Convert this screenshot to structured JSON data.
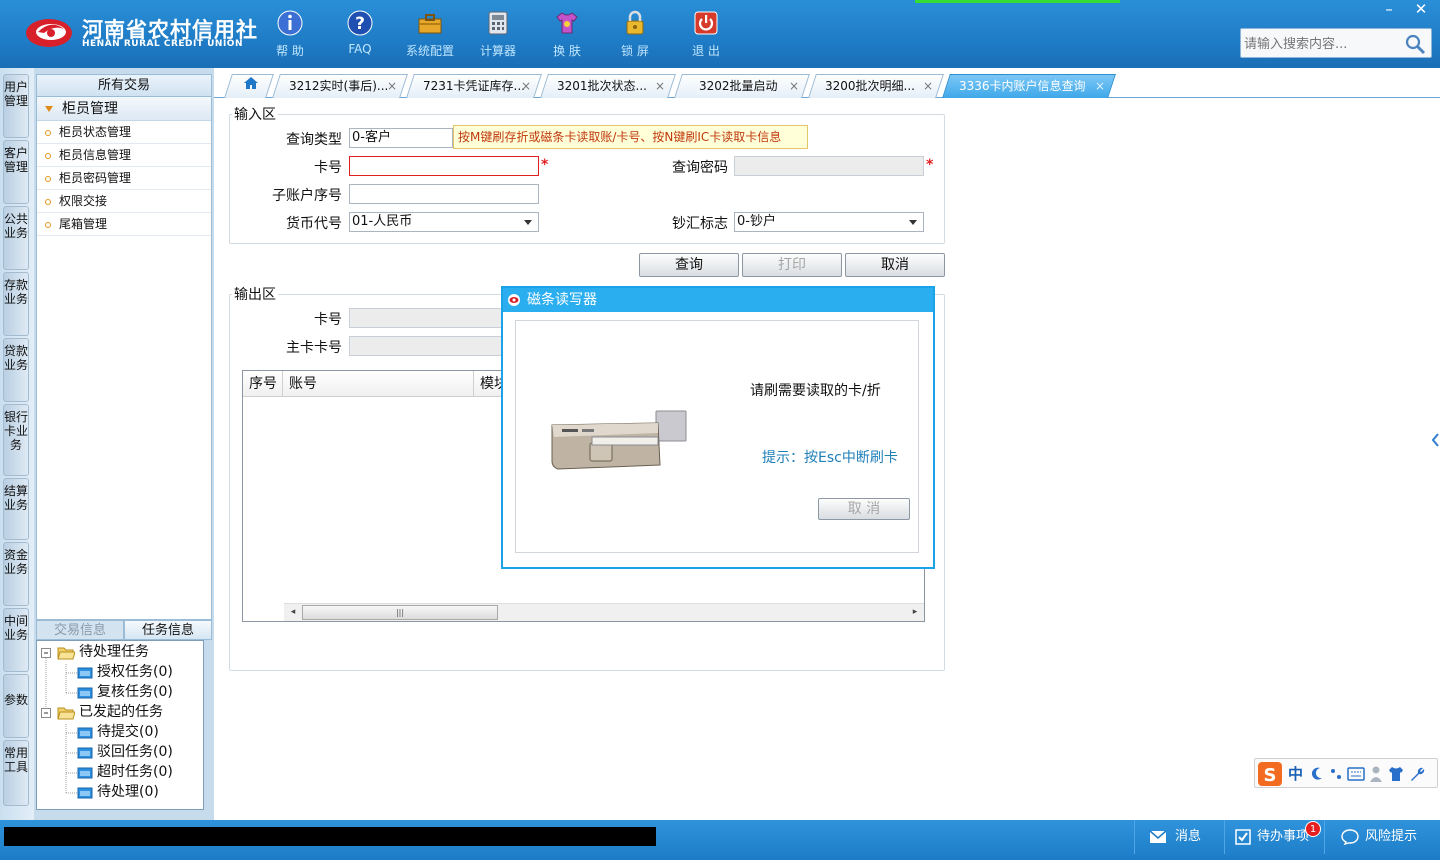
{
  "brand": {
    "name_cn": "河南省农村信用社",
    "name_en": "HENAN RURAL CREDIT UNION"
  },
  "toolbar": [
    {
      "label": "帮 助",
      "icon": "info-icon"
    },
    {
      "label": "FAQ",
      "icon": "question-icon"
    },
    {
      "label": "系统配置",
      "icon": "toolbox-icon"
    },
    {
      "label": "计算器",
      "icon": "calculator-icon"
    },
    {
      "label": "换 肤",
      "icon": "tshirt-icon"
    },
    {
      "label": "锁 屏",
      "icon": "lock-icon"
    },
    {
      "label": "退 出",
      "icon": "power-icon"
    }
  ],
  "window": {
    "minimize": "–",
    "close": "✕"
  },
  "search": {
    "placeholder": "请输入搜索内容..."
  },
  "vertical_tabs": [
    "用户管理",
    "客户管理",
    "公共业务",
    "存款业务",
    "贷款业务",
    "银行卡业务",
    "结算业务",
    "资金业务",
    "中间业务",
    "参数",
    "常用工具"
  ],
  "nav": {
    "header": "所有交易",
    "group": "柜员管理",
    "items": [
      "柜员状态管理",
      "柜员信息管理",
      "柜员密码管理",
      "权限交接",
      "尾箱管理"
    ]
  },
  "info_tabs": [
    "交易信息",
    "任务信息"
  ],
  "tree": {
    "pending": "待处理任务",
    "pending_children": [
      "授权任务(0)",
      "复核任务(0)"
    ],
    "initiated": "已发起的任务",
    "initiated_children": [
      "待提交(0)",
      "驳回任务(0)",
      "超时任务(0)",
      "待处理(0)"
    ]
  },
  "tabs": [
    {
      "label": "3212实时(事后)..."
    },
    {
      "label": "7231卡凭证库存..."
    },
    {
      "label": "3201批次状态..."
    },
    {
      "label": "3202批量启动"
    },
    {
      "label": "3200批次明细..."
    },
    {
      "label": "3336卡内账户信息查询"
    }
  ],
  "form": {
    "input_legend": "输入区",
    "query_type_label": "查询类型",
    "query_type_value": "0-客户",
    "card_no_label": "卡号",
    "card_no_value": "",
    "password_label": "查询密码",
    "sub_account_label": "子账户序号",
    "currency_label": "货币代号",
    "currency_value": "01-人民币",
    "cash_flag_label": "钞汇标志",
    "cash_flag_value": "0-钞户",
    "required_mark": "*",
    "tooltip": "按M键刷存折或磁条卡读取账/卡号、按N键刷IC卡读取卡信息"
  },
  "buttons": {
    "query": "查询",
    "print": "打印",
    "cancel": "取消"
  },
  "output": {
    "legend": "输出区",
    "card_no_label": "卡号",
    "main_card_label": "主卡卡号",
    "grid_columns": [
      "序号",
      "账号",
      "模块"
    ]
  },
  "dialog": {
    "title": "磁条读写器",
    "message": "请刷需要读取的卡/折",
    "hint": "提示：按Esc中断刷卡",
    "cancel": "取 消"
  },
  "ime": {
    "label": "中"
  },
  "statusbar": {
    "messages": "消息",
    "todo": "待办事项",
    "todo_count": "1",
    "risk": "风险提示"
  },
  "colors": {
    "header_blue": "#1f7cc6",
    "accent_active_tab": "#3ea8ea",
    "dialog_border": "#1aa3e8",
    "error_red": "#e02020"
  }
}
